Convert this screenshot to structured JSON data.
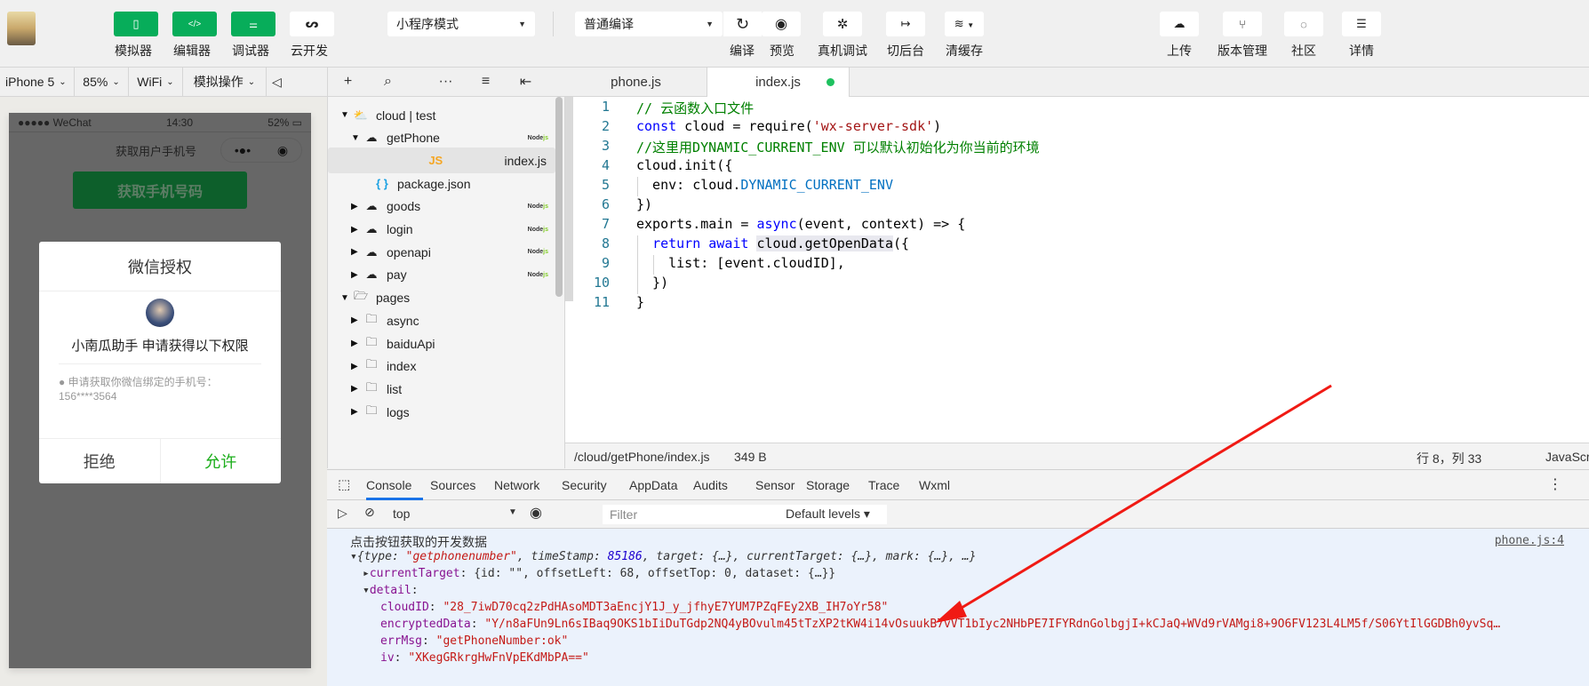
{
  "toolbar": {
    "simulator_label": "模拟器",
    "editor_label": "编辑器",
    "debugger_label": "调试器",
    "cloud_label": "云开发",
    "mode_select": "小程序模式",
    "compile_select": "普通编译",
    "compile_label": "编译",
    "preview_label": "预览",
    "remote_debug_label": "真机调试",
    "background_label": "切后台",
    "clear_cache_label": "清缓存",
    "upload_label": "上传",
    "version_label": "版本管理",
    "community_label": "社区",
    "details_label": "详情"
  },
  "subbar": {
    "device": "iPhone 5",
    "zoom": "85%",
    "network": "WiFi",
    "simulate_ops": "模拟操作"
  },
  "phone": {
    "carrier": "●●●●● WeChat",
    "time": "14:30",
    "battery": "52%",
    "nav_title": "获取用户手机号",
    "get_phone_button": "获取手机号码",
    "dialog": {
      "title": "微信授权",
      "app_request": "小南瓜助手 申请获得以下权限",
      "permission": "● 申请获取你微信绑定的手机号：156****3564",
      "deny": "拒绝",
      "allow": "允许"
    }
  },
  "tree": {
    "items": [
      {
        "label": "cloud | test",
        "expanded": true,
        "type": "cloud-root"
      },
      {
        "label": "getPhone",
        "expanded": true,
        "type": "cloud-function",
        "badge": "Node"
      },
      {
        "label": "index.js",
        "type": "js",
        "selected": true
      },
      {
        "label": "package.json",
        "type": "json"
      },
      {
        "label": "goods",
        "type": "cloud-function",
        "badge": "Node"
      },
      {
        "label": "login",
        "type": "cloud-function",
        "badge": "Node"
      },
      {
        "label": "openapi",
        "type": "cloud-function",
        "badge": "Node"
      },
      {
        "label": "pay",
        "type": "cloud-function",
        "badge": "Node"
      },
      {
        "label": "pages",
        "expanded": true,
        "type": "folder-open"
      },
      {
        "label": "async",
        "type": "folder"
      },
      {
        "label": "baiduApi",
        "type": "folder"
      },
      {
        "label": "index",
        "type": "folder"
      },
      {
        "label": "list",
        "type": "folder"
      },
      {
        "label": "logs",
        "type": "folder"
      }
    ],
    "badge_suffix": "js"
  },
  "editor": {
    "tabs": [
      {
        "label": "phone.js"
      },
      {
        "label": "index.js",
        "active": true,
        "unsaved": true
      }
    ],
    "lines": [
      [
        {
          "t": "// 云函数入口文件",
          "c": "c-com"
        }
      ],
      [
        {
          "t": "const",
          "c": "c-kw"
        },
        {
          "t": " cloud = require("
        },
        {
          "t": "'wx-server-sdk'",
          "c": "c-str"
        },
        {
          "t": ")"
        }
      ],
      [
        {
          "t": "//这里用DYNAMIC_CURRENT_ENV 可以默认初始化为你当前的环境",
          "c": "c-com"
        }
      ],
      [
        {
          "t": "cloud.init({"
        }
      ],
      [
        {
          "t": "  env: cloud."
        },
        {
          "t": "DYNAMIC_CURRENT_ENV",
          "c": "c-const"
        }
      ],
      [
        {
          "t": "})"
        }
      ],
      [
        {
          "t": "exports.main = "
        },
        {
          "t": "async",
          "c": "c-kw"
        },
        {
          "t": "(event, context) => {"
        }
      ],
      [
        {
          "t": "  "
        },
        {
          "t": "return",
          "c": "c-kw"
        },
        {
          "t": " "
        },
        {
          "t": "await",
          "c": "c-kw"
        },
        {
          "t": " "
        },
        {
          "t": "cloud.getOpenData",
          "c": "hl"
        },
        {
          "t": "({"
        }
      ],
      [
        {
          "t": "    list: [event.cloudID],"
        }
      ],
      [
        {
          "t": "  })"
        }
      ],
      [
        {
          "t": "}"
        }
      ]
    ],
    "status": {
      "path": "/cloud/getPhone/index.js",
      "size": "349 B",
      "cursor": "行 8，列 33",
      "language": "JavaScript"
    }
  },
  "devtools": {
    "tabs": [
      "Console",
      "Sources",
      "Network",
      "Security",
      "AppData",
      "Audits",
      "Sensor",
      "Storage",
      "Trace",
      "Wxml"
    ],
    "active_tab": "Console",
    "context": "top",
    "filter_placeholder": "Filter",
    "levels": "Default levels",
    "console": {
      "source_link": "phone.js:4",
      "heading": "点击按钮获取的开发数据",
      "event_summary_type": "\"getphonenumber\"",
      "event_summary_timestamp": "85186",
      "current_target": "{id: \"\", offsetLeft: 68, offsetTop: 0, dataset: {…}}",
      "detail_label": "detail",
      "cloudID": "\"28_7iwD70cq2zPdHAsoMDT3aEncjY1J_y_jfhyE7YUM7PZqFEy2XB_IH7oYr58\"",
      "encryptedData": "\"Y/n8aFUn9Ln6sIBaq9OKS1bIiDuTGdp2NQ4yBOvulm45tTzXP2tKW4i14vOsuukB7vVT1bIyc2NHbPE7IFYRdnGolbgjI+kCJaQ+WVd9rVAMgi8+9O6FV123L4LM5f/S06YtIlGGDBh0yvSq…",
      "errMsg": "\"getPhoneNumber:ok\"",
      "iv": "\"XKegGRkrgHwFnVpEKdMbPA==\""
    }
  },
  "colors": {
    "brand_green": "#07ad5a",
    "allow_green": "#1aad19",
    "annotation_red": "#f01a14",
    "tab_underline": "#1a73e8"
  }
}
